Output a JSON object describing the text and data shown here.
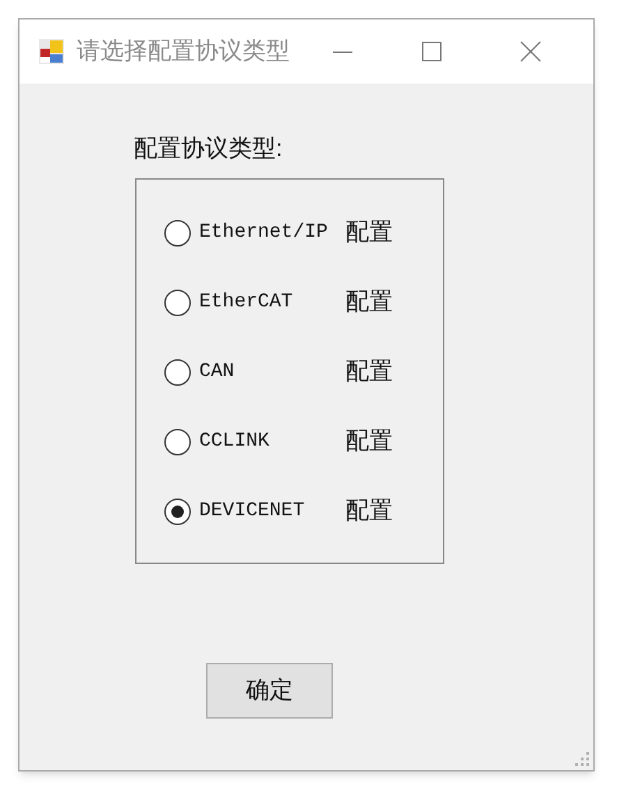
{
  "window": {
    "title": "请选择配置协议类型"
  },
  "group": {
    "label": "配置协议类型:"
  },
  "options": [
    {
      "label": "Ethernet/IP",
      "action": "配置",
      "selected": false
    },
    {
      "label": "EtherCAT",
      "action": "配置",
      "selected": false
    },
    {
      "label": "CAN",
      "action": "配置",
      "selected": false
    },
    {
      "label": "CCLINK",
      "action": "配置",
      "selected": false
    },
    {
      "label": "DEVICENET",
      "action": "配置",
      "selected": true
    }
  ],
  "buttons": [
    "确定"
  ]
}
